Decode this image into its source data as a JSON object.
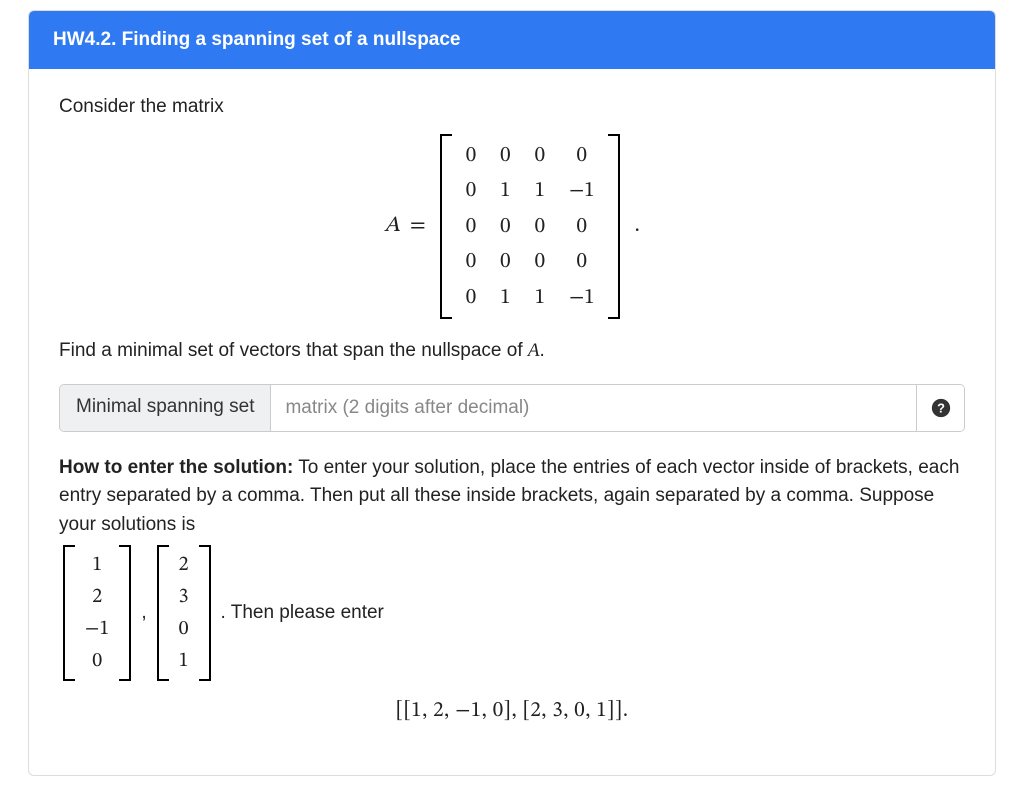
{
  "header": {
    "title": "HW4.2. Finding a spanning set of a nullspace"
  },
  "intro": "Consider the matrix",
  "equation": {
    "lhs": "A",
    "eq": "=",
    "matrix": [
      [
        "0",
        "0",
        "0",
        "0"
      ],
      [
        "0",
        "1",
        "1",
        "−1"
      ],
      [
        "0",
        "0",
        "0",
        "0"
      ],
      [
        "0",
        "0",
        "0",
        "0"
      ],
      [
        "0",
        "1",
        "1",
        "−1"
      ]
    ],
    "trail": "."
  },
  "prompt_pre": "Find a minimal set of vectors that span the nullspace of ",
  "prompt_var": "A",
  "prompt_post": ".",
  "input": {
    "label": "Minimal spanning set",
    "placeholder": "matrix (2 digits after decimal)",
    "help_icon": "help-circle-icon"
  },
  "instructions": {
    "lead": "How to enter the solution:",
    "line1": " To enter your solution, place the entries of each vector inside of brackets, each entry separated by a comma. Then put all these inside brackets, again separated by a comma. Suppose your solutions is ",
    "vec1": [
      "1",
      "2",
      "−1",
      "0"
    ],
    "comma": ",",
    "vec2": [
      "2",
      "3",
      "0",
      "1"
    ],
    "tail": ". Then please enter",
    "example": "[[1, 2, −1, 0], [2, 3, 0, 1]]."
  }
}
